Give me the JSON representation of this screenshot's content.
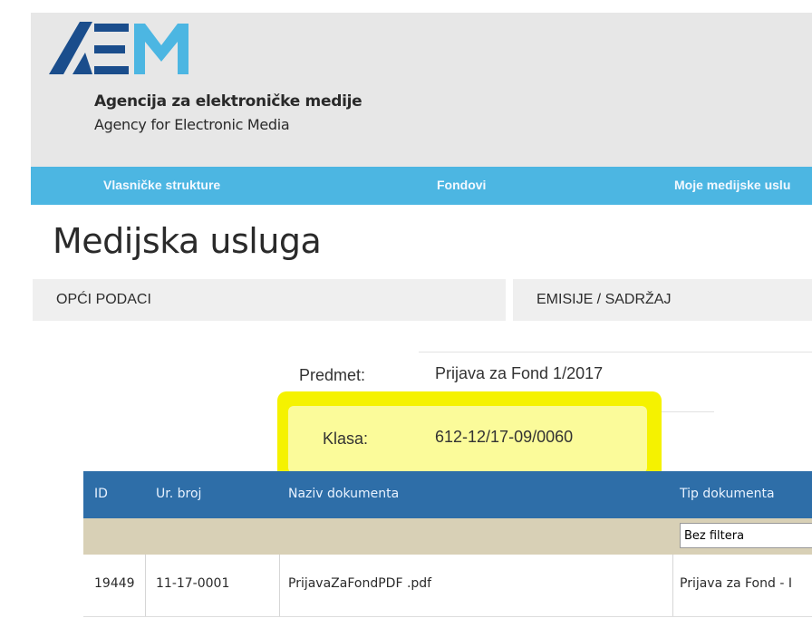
{
  "brand": {
    "name": "Agencija za elektroničke medije",
    "name_en": "Agency for Electronic Media",
    "colors": {
      "dark": "#1a4d8c",
      "light": "#4cb6e2"
    }
  },
  "nav": {
    "items": [
      {
        "label": "Vlasničke strukture"
      },
      {
        "label": "Fondovi"
      },
      {
        "label": "Moje medijske uslu"
      }
    ]
  },
  "page": {
    "title": "Medijska usluga"
  },
  "tabs": [
    {
      "label": "OPĆI PODACI"
    },
    {
      "label": "EMISIJE / SADRŽAJ"
    }
  ],
  "details": {
    "predmet_label": "Predmet:",
    "predmet_value": "Prijava za Fond 1/2017",
    "klasa_label": "Klasa:",
    "klasa_value": "612-12/17-09/0060"
  },
  "table": {
    "headers": [
      "ID",
      "Ur. broj",
      "Naziv dokumenta",
      "Tip dokumenta"
    ],
    "filter_value": "Bez filtera",
    "rows": [
      {
        "id": "19449",
        "ur_broj": "11-17-0001",
        "naziv": "PrijavaZaFondPDF .pdf",
        "tip": "Prijava za Fond - I"
      }
    ]
  },
  "highlight_color": "#f5f200"
}
